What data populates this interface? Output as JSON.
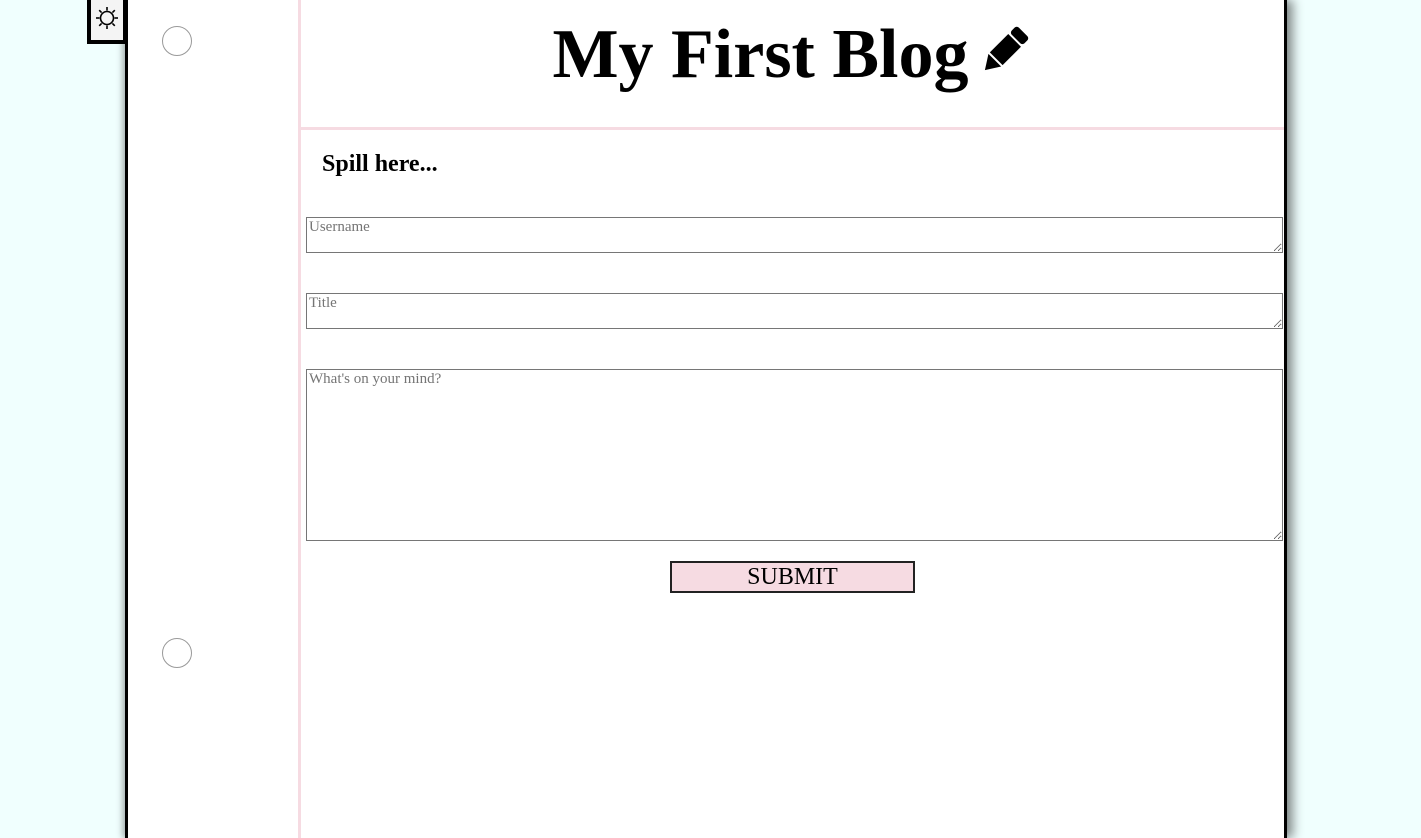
{
  "theme_toggle": {
    "icon": "sun-icon"
  },
  "header": {
    "title": "My First Blog",
    "title_icon": "pencil-icon"
  },
  "form": {
    "heading": "Spill here...",
    "username_placeholder": "Username",
    "username_value": "",
    "title_placeholder": "Title",
    "title_value": "",
    "content_placeholder": "What's on your mind?",
    "content_value": "",
    "submit_label": "SUBMIT"
  },
  "colors": {
    "background": "#f0fffe",
    "page": "#ffffff",
    "accent_pink": "#f6dbe2",
    "border": "#000000"
  }
}
